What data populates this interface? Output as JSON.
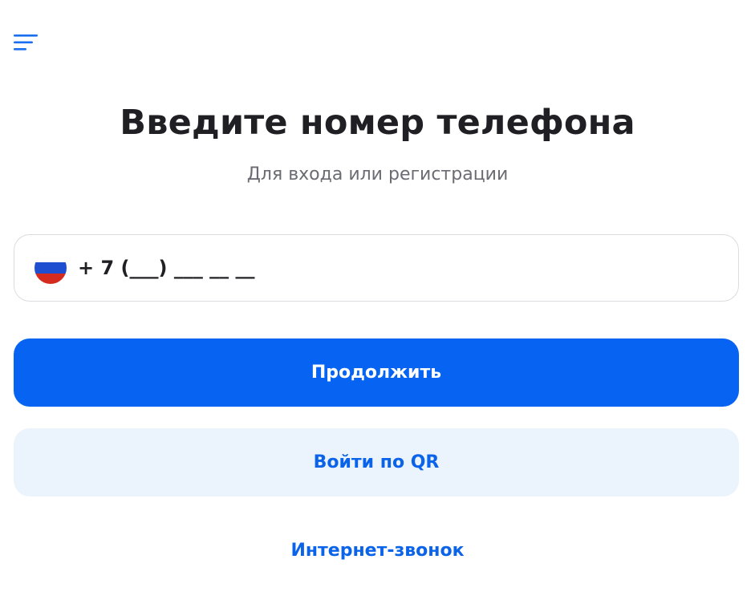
{
  "header": {
    "menu_icon": "hamburger-menu-icon"
  },
  "main": {
    "title": "Введите номер телефона",
    "subtitle": "Для входа или регистрации"
  },
  "phone": {
    "country_flag_icon": "russia-flag-icon",
    "placeholder": "+ 7 (___) ___ __ __",
    "value": ""
  },
  "actions": {
    "continue_label": "Продолжить",
    "qr_label": "Войти по QR",
    "internet_call_label": "Интернет-звонок"
  },
  "colors": {
    "primary": "#0764f2",
    "secondary_bg": "#ebf3fd",
    "link": "#0a63e8",
    "title": "#1f1f24",
    "subtitle": "#6b6b73"
  }
}
